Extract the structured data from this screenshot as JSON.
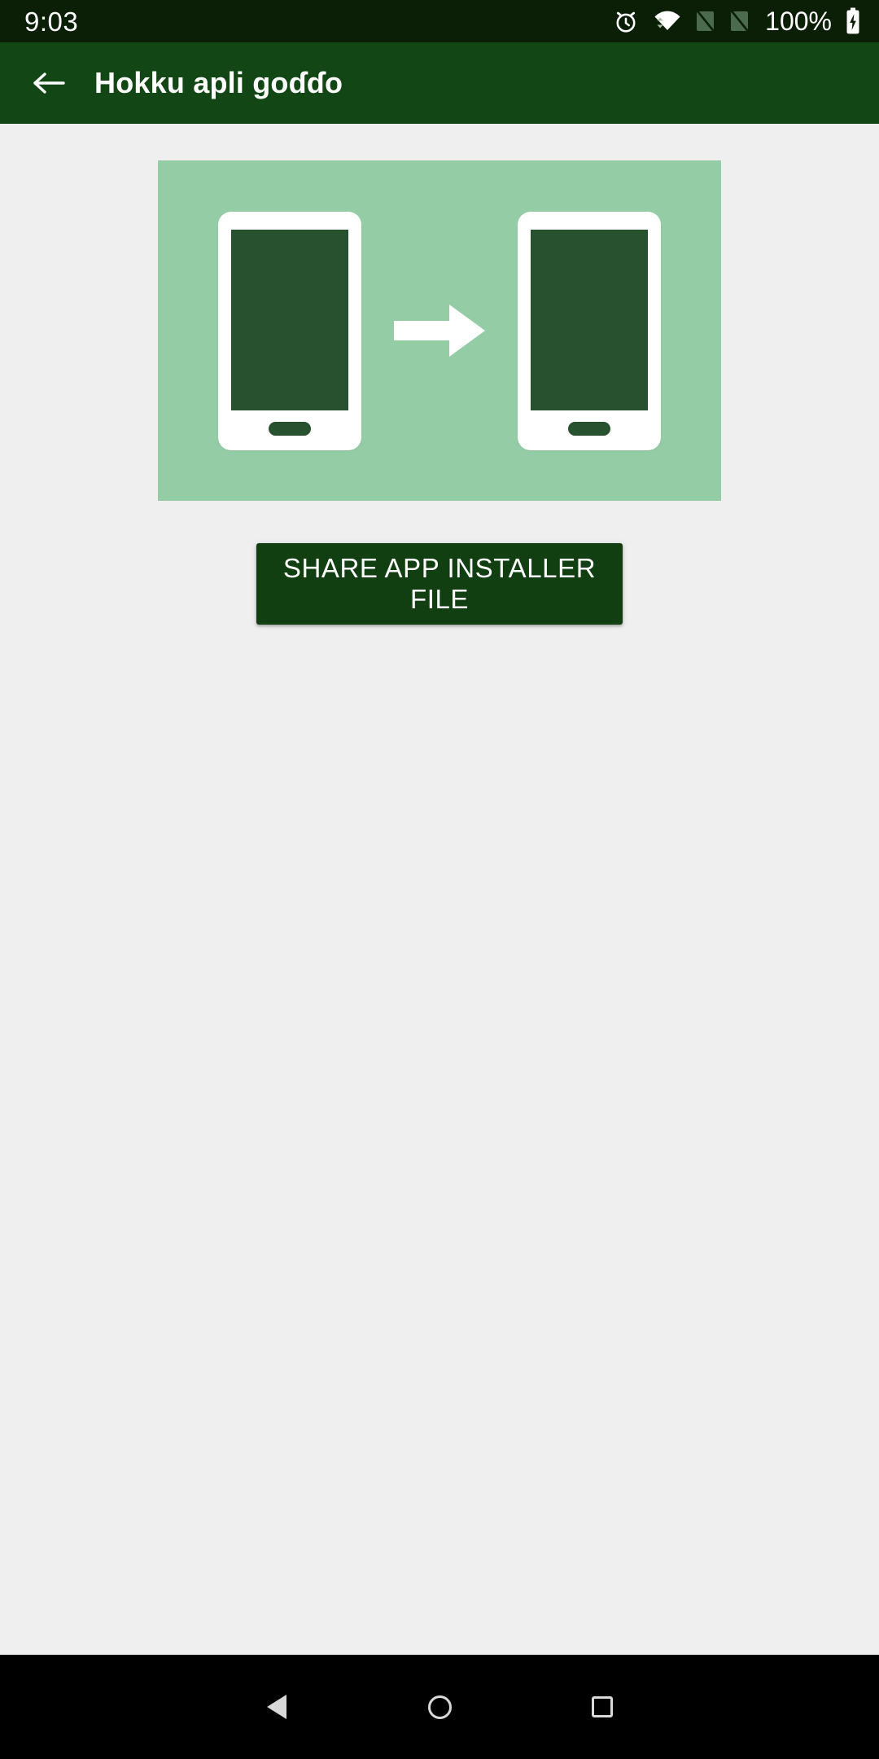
{
  "status_bar": {
    "clock": "9:03",
    "battery_percent": "100%",
    "icons": [
      {
        "name": "alarm-icon",
        "label": "alarm"
      },
      {
        "name": "wifi-icon",
        "label": "wifi"
      },
      {
        "name": "signal-no-sim-1-icon",
        "label": "no signal sim 1"
      },
      {
        "name": "signal-no-sim-2-icon",
        "label": "no signal sim 2"
      },
      {
        "name": "battery-charging-icon",
        "label": "battery charging"
      }
    ],
    "background_color": "#0a1f06",
    "foreground_color": "#ffffff"
  },
  "app_bar": {
    "title": "Hokku apli goɗɗo",
    "back_label": "Navigate up",
    "background_color": "#134615",
    "title_color": "#ffffff"
  },
  "main": {
    "hero": {
      "name": "share-illustration",
      "alt": "Two phones with an arrow indicating transfer",
      "background_color": "#93cca5",
      "phone_body_color": "#ffffff",
      "phone_screen_color": "#27512f",
      "arrow_color": "#ffffff"
    },
    "share_button": {
      "label": "SHARE APP INSTALLER FILE",
      "background_color": "#113f11",
      "text_color": "#ffffff"
    },
    "background_color": "#efefef"
  },
  "nav_bar": {
    "background_color": "#000000",
    "buttons": [
      {
        "name": "nav-back-button",
        "label": "Back"
      },
      {
        "name": "nav-home-button",
        "label": "Home"
      },
      {
        "name": "nav-recents-button",
        "label": "Recents"
      }
    ]
  }
}
